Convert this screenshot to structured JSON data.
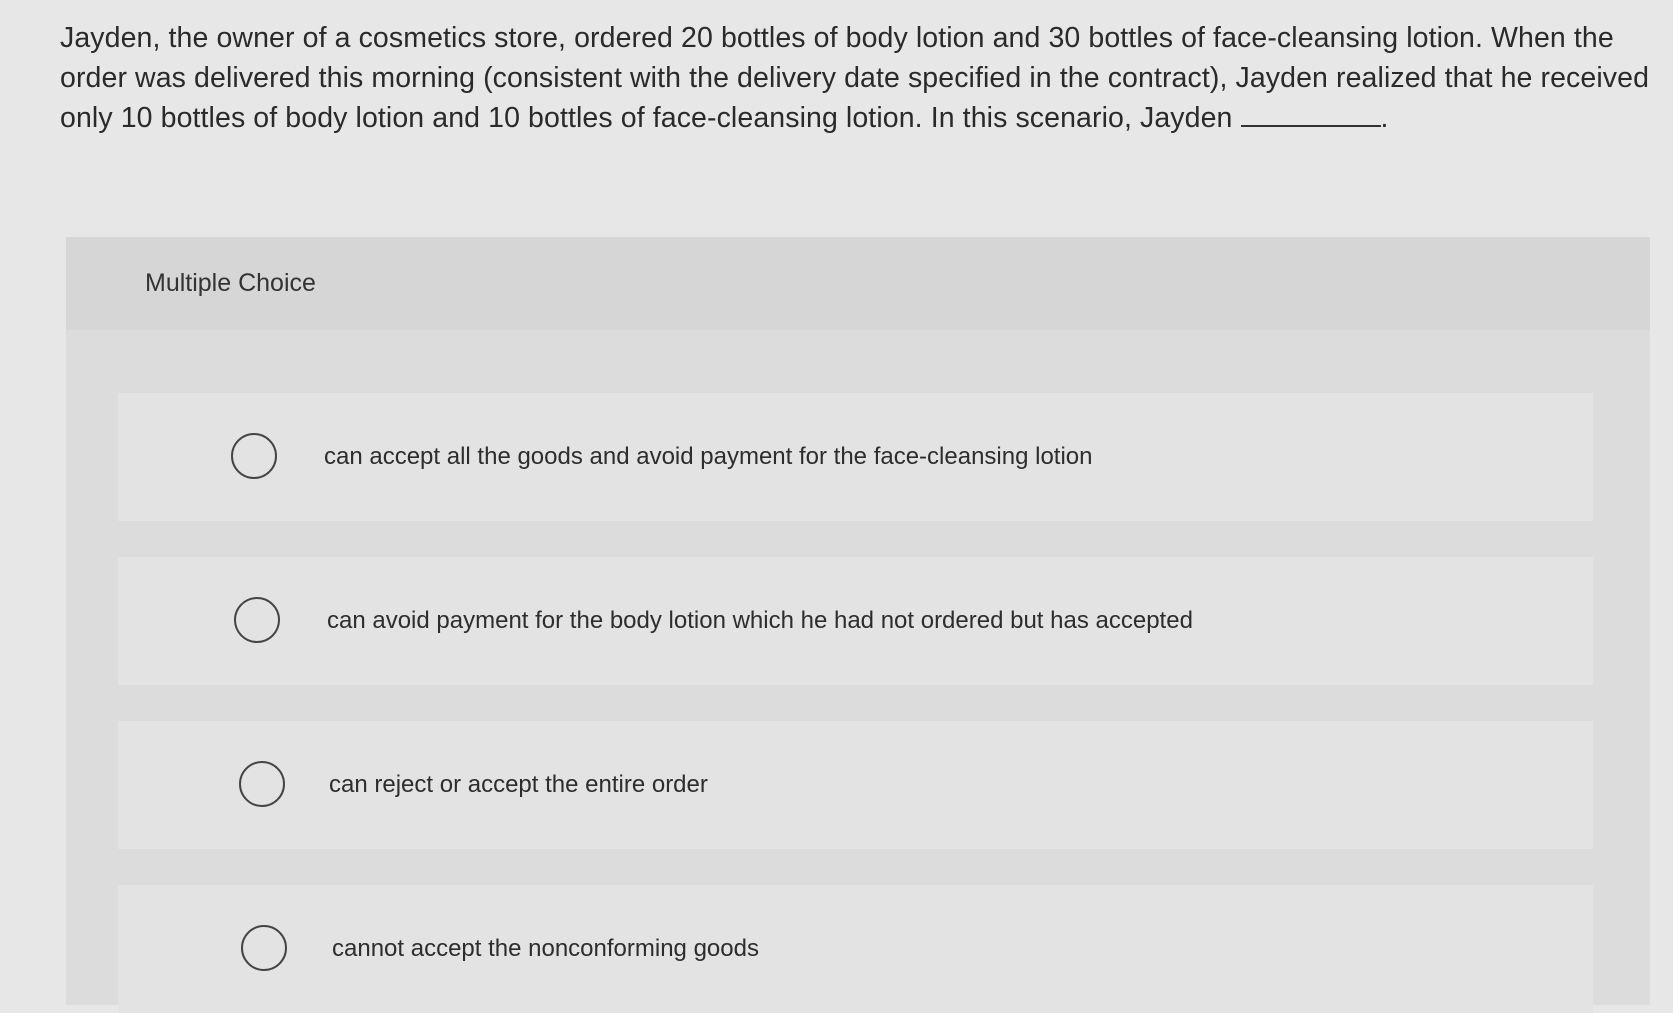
{
  "question": {
    "text": "Jayden, the owner of a cosmetics store, ordered 20 bottles of body lotion and 30 bottles of face-cleansing lotion. When the order was delivered this morning (consistent with the delivery date specified in the contract), Jayden realized that he received only 10 bottles of body lotion and 10 bottles of face-cleansing lotion. In this scenario, Jayden",
    "end_punct": "."
  },
  "multiple_choice": {
    "title": "Multiple Choice",
    "options": [
      {
        "label": "can accept all the goods and avoid payment for the face-cleansing lotion"
      },
      {
        "label": "can avoid payment for the body lotion which he had not ordered but has accepted"
      },
      {
        "label": "can reject or accept the entire order"
      },
      {
        "label": "cannot accept the nonconforming goods"
      }
    ]
  }
}
